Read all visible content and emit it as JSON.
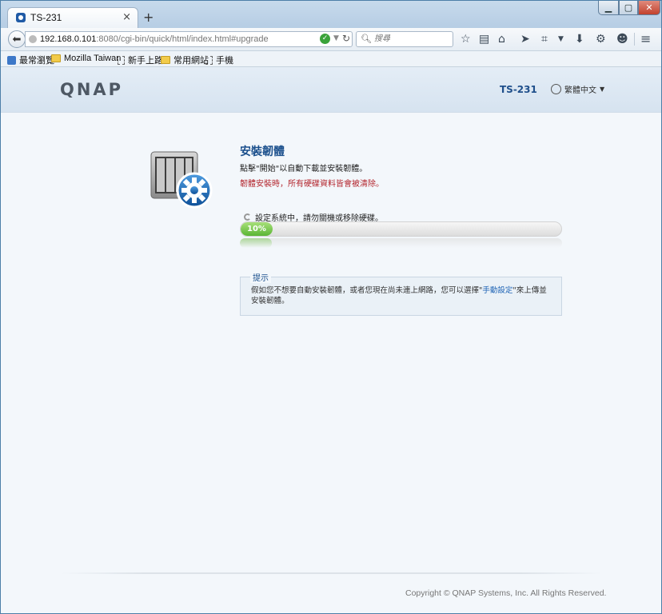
{
  "browser": {
    "tab_title": "TS-231",
    "tab_close": "×",
    "new_tab": "+",
    "url_host": "192.168.0.101",
    "url_rest": ":8080/cgi-bin/quick/html/index.html#upgrade",
    "search_placeholder": "搜尋",
    "window_controls": {
      "minimize": "▁",
      "maximize": "▢",
      "close": "✕"
    },
    "toolbar_icons": [
      "star-icon",
      "reading-list-icon",
      "home-icon",
      "send-icon",
      "crop-icon",
      "download-icon",
      "gear-icon",
      "smiley-icon",
      "menu-icon"
    ]
  },
  "bookmarks": [
    {
      "label": "最常瀏覽",
      "icon": "bookmark-star-icon"
    },
    {
      "label": "Mozilla Taiwan",
      "icon": "folder-icon"
    },
    {
      "label": "新手上路",
      "icon": "page-icon"
    },
    {
      "label": "常用網站",
      "icon": "folder-icon"
    },
    {
      "label": "手機",
      "icon": "page-icon"
    }
  ],
  "header": {
    "logo": "QNAP",
    "model": "TS-231",
    "language": "繁體中文"
  },
  "main": {
    "title": "安裝韌體",
    "description": "點擊\"開始\"以自動下載並安裝韌體。",
    "warning": "韌體安裝時，所有硬碟資料皆會被清除。",
    "status": "設定系統中，請勿關機或移除硬碟。",
    "progress": {
      "percent": 10,
      "label": "10%"
    },
    "hint": {
      "legend": "提示",
      "text_before": "假如您不想要自動安裝韌體，或者您現在尚未連上網路，您可以選擇\"",
      "link": "手動設定",
      "text_after": "\"來上傳並安裝韌體。"
    }
  },
  "footer": {
    "copyright": "Copyright © QNAP Systems, Inc. All Rights Reserved."
  },
  "colors": {
    "accent": "#1a4f8c",
    "warning": "#b3262e",
    "progress": "#5ab534",
    "link": "#1f64b5"
  }
}
